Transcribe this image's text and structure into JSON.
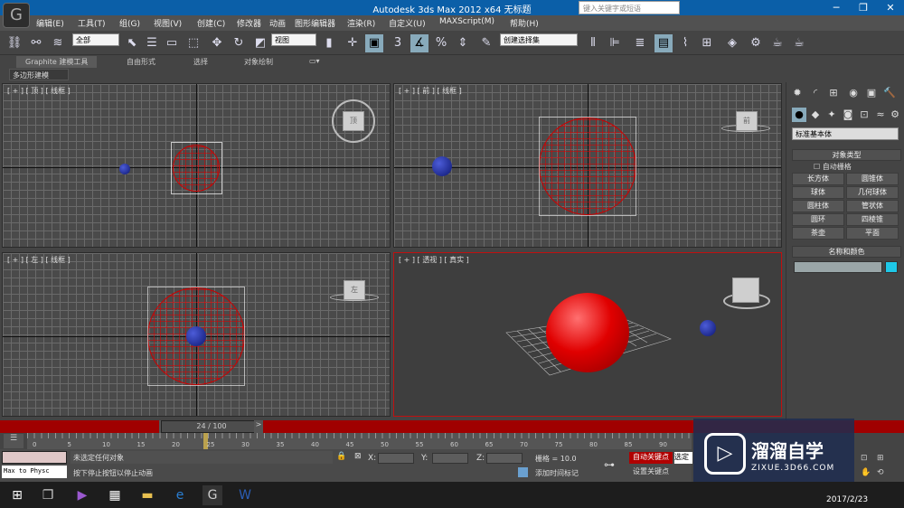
{
  "app": {
    "title": "Autodesk 3ds Max  2012 x64      无标题",
    "logo": "3ds-max-logo"
  },
  "menus": [
    "编辑(E)",
    "工具(T)",
    "组(G)",
    "视图(V)",
    "创建(C)",
    "修改器",
    "动画",
    "图形编辑器",
    "渲染(R)",
    "自定义(U)",
    "MAXScript(M)",
    "帮助(H)"
  ],
  "search": {
    "placeholder": "键入关键字或短语"
  },
  "toolbar": {
    "selection_filter": "全部",
    "ref_coord": "视图",
    "named_selection": "创建选择集"
  },
  "ribbon": {
    "tabs": [
      "Graphite 建模工具",
      "自由形式",
      "选择",
      "对象绘制"
    ],
    "sub_tab": "多边形建模"
  },
  "viewports": [
    {
      "label": "[ + ] [ 顶 ] [ 线框 ]"
    },
    {
      "label": "[ + ] [ 前 ] [ 线框 ]"
    },
    {
      "label": "[ + ] [ 左 ] [ 线框 ]"
    },
    {
      "label": "[ + ] [ 透视 ] [ 真实 ]"
    }
  ],
  "viewcube": {
    "top": "顶",
    "front": "前",
    "left": "左"
  },
  "command_panel": {
    "category": "标准基本体",
    "object_type_title": "对象类型",
    "autogrid": "自动栅格",
    "buttons": [
      "长方体",
      "圆锥体",
      "球体",
      "几何球体",
      "圆柱体",
      "管状体",
      "圆环",
      "四棱锥",
      "茶壶",
      "平面"
    ],
    "name_color_title": "名称和颜色"
  },
  "timeline": {
    "frame": "24 / 100",
    "ticks": [
      "0",
      "5",
      "10",
      "15",
      "20",
      "25",
      "30",
      "35",
      "40",
      "45",
      "50",
      "55",
      "60",
      "65",
      "70",
      "75",
      "80",
      "85",
      "90"
    ]
  },
  "status": {
    "script_listener": "Max to Physc",
    "selection": "未选定任何对象",
    "prompt": "按下停止按钮以停止动画",
    "x_label": "X:",
    "y_label": "Y:",
    "z_label": "Z:",
    "grid": "栅格 = 10.0",
    "add_time_tag": "添加时间标记",
    "auto_key": "自动关键点",
    "set_key": "设置关键点",
    "selected": "选定"
  },
  "watermark": {
    "brand": "溜溜自学",
    "url": "ZIXUE.3D66.COM"
  },
  "taskbar": {
    "date": "2017/2/23"
  }
}
